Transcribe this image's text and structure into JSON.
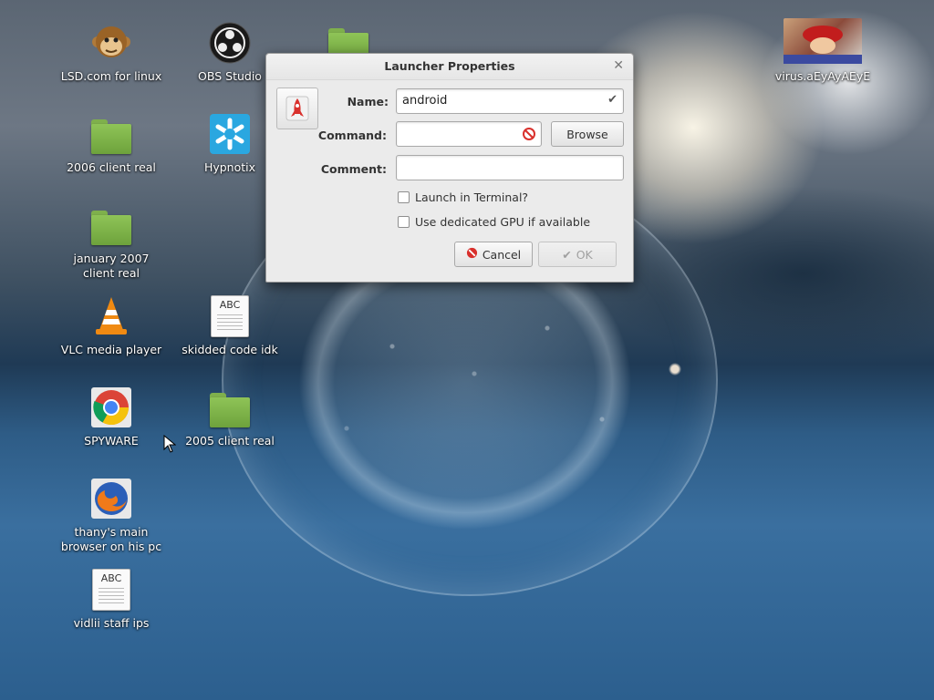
{
  "desktop": {
    "icons": [
      {
        "label": "LSD.com for linux",
        "icon": "monkey-icon"
      },
      {
        "label": "OBS Studio",
        "icon": "obs-icon"
      },
      {
        "label": "2006 client real",
        "icon": "folder-icon"
      },
      {
        "label": "Hypnotix",
        "icon": "hypnotix-icon"
      },
      {
        "label": "january 2007\nclient real",
        "icon": "folder-icon"
      },
      {
        "label": "VLC media player",
        "icon": "vlc-icon"
      },
      {
        "label": "skidded code idk",
        "icon": "text-document-icon"
      },
      {
        "label": "SPYWARE",
        "icon": "chrome-icon"
      },
      {
        "label": "2005 client real",
        "icon": "folder-icon"
      },
      {
        "label": "thany's main\nbrowser on his pc",
        "icon": "firefox-icon"
      },
      {
        "label": "vidlii staff ips",
        "icon": "text-document-icon"
      },
      {
        "label": "virus.aEyAyAEyE",
        "icon": "image-thumbnail-icon"
      }
    ],
    "doc_icon_text": "ABC"
  },
  "dialog": {
    "title": "Launcher Properties",
    "name_label": "Name:",
    "name_value": "android",
    "command_label": "Command:",
    "command_value": "",
    "comment_label": "Comment:",
    "comment_value": "",
    "browse_label": "Browse",
    "launch_in_terminal_label": "Launch in Terminal?",
    "launch_in_terminal_checked": false,
    "dedicated_gpu_label": "Use dedicated GPU if available",
    "dedicated_gpu_checked": false,
    "cancel_label": "Cancel",
    "ok_label": "OK"
  },
  "colors": {
    "folder": "#7fb04c",
    "cancel_icon": "#d9302c",
    "valid_check": "#555555"
  }
}
